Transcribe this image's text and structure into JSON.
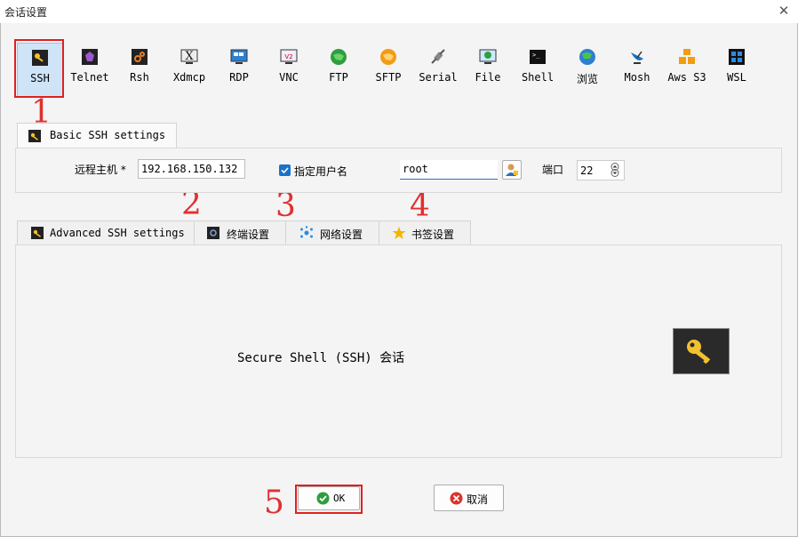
{
  "window": {
    "title": "会话设置"
  },
  "protocols": [
    {
      "label": "SSH"
    },
    {
      "label": "Telnet"
    },
    {
      "label": "Rsh"
    },
    {
      "label": "Xdmcp"
    },
    {
      "label": "RDP"
    },
    {
      "label": "VNC"
    },
    {
      "label": "FTP"
    },
    {
      "label": "SFTP"
    },
    {
      "label": "Serial"
    },
    {
      "label": "File"
    },
    {
      "label": "Shell"
    },
    {
      "label": "浏览"
    },
    {
      "label": "Mosh"
    },
    {
      "label": "Aws S3"
    },
    {
      "label": "WSL"
    }
  ],
  "annotations": [
    "1",
    "2",
    "3",
    "4",
    "5"
  ],
  "basic": {
    "tab_label": "Basic SSH settings",
    "remote_host_label": "远程主机 *",
    "remote_host_value": "192.168.150.132",
    "specify_user_label": "指定用户名",
    "specify_user_checked": true,
    "username_value": "root",
    "port_label": "端口",
    "port_value": "22"
  },
  "adv_tabs": [
    {
      "label": "Advanced SSH settings"
    },
    {
      "label": "终端设置"
    },
    {
      "label": "网络设置"
    },
    {
      "label": "书签设置"
    }
  ],
  "content": {
    "description": "Secure Shell (SSH) 会话"
  },
  "buttons": {
    "ok_label": "OK",
    "cancel_label": "取消"
  },
  "colors": {
    "annotation_red": "#e02020",
    "key_yellow": "#f2c12e",
    "check_blue": "#1a73c8"
  }
}
